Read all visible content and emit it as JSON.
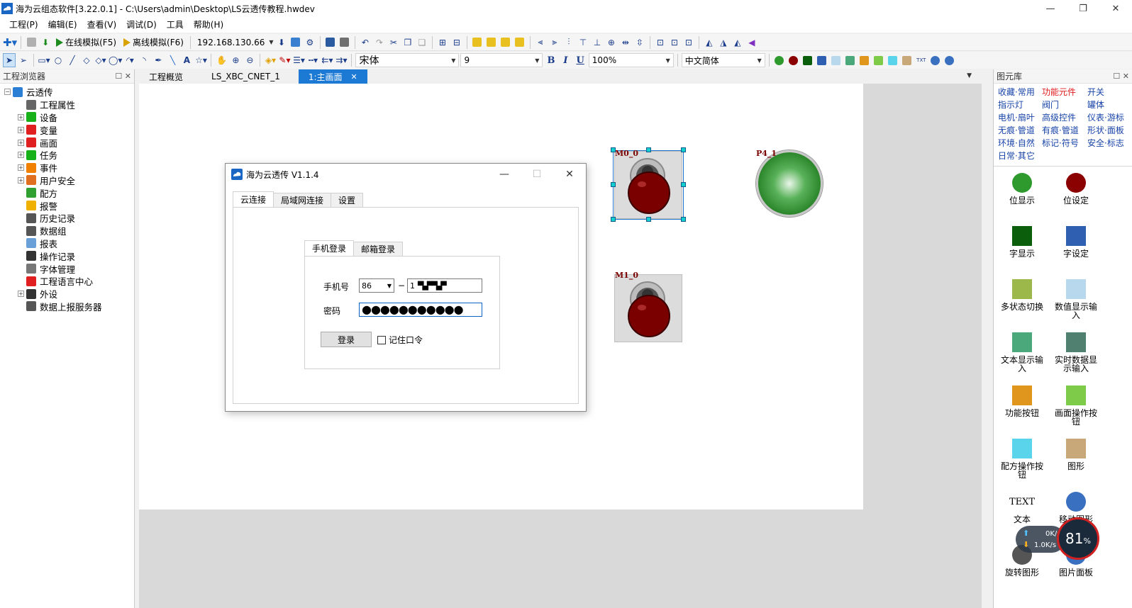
{
  "window": {
    "title": "海为云组态软件[3.22.0.1] - C:\\Users\\admin\\Desktop\\LS云透传教程.hwdev",
    "minimize": "—",
    "maximize": "❐",
    "close": "✕"
  },
  "menu": [
    "工程(P)",
    "编辑(E)",
    "查看(V)",
    "调试(D)",
    "工具",
    "帮助(H)"
  ],
  "toolbar1": {
    "online_sim": "在线模拟(F5)",
    "offline_sim": "离线模拟(F6)",
    "ip": "192.168.130.66"
  },
  "toolbar2": {
    "font": "宋体",
    "size": "9",
    "zoom": "100%",
    "language": "中文简体",
    "bold": "B",
    "italic": "I",
    "underline": "U",
    "text_tool": "A"
  },
  "left_panel": {
    "title": "工程浏览器",
    "pin": "☐ ✕",
    "tree": [
      {
        "label": "云透传",
        "level": 0,
        "expander": "−",
        "icon": "project-icon",
        "color": "#2a7fd4"
      },
      {
        "label": "工程属性",
        "level": 1,
        "expander": "",
        "icon": "properties-icon",
        "color": "#666666"
      },
      {
        "label": "设备",
        "level": 1,
        "expander": "+",
        "icon": "device-icon",
        "color": "#18b018"
      },
      {
        "label": "变量",
        "level": 1,
        "expander": "+",
        "icon": "variable-icon",
        "color": "#e02020"
      },
      {
        "label": "画面",
        "level": 1,
        "expander": "+",
        "icon": "screen-icon",
        "color": "#e02020"
      },
      {
        "label": "任务",
        "level": 1,
        "expander": "+",
        "icon": "task-icon",
        "color": "#18b018"
      },
      {
        "label": "事件",
        "level": 1,
        "expander": "+",
        "icon": "event-icon",
        "color": "#f08000"
      },
      {
        "label": "用户安全",
        "level": 1,
        "expander": "+",
        "icon": "user-security-icon",
        "color": "#e07020"
      },
      {
        "label": "配方",
        "level": 1,
        "expander": "",
        "icon": "recipe-icon",
        "color": "#30a030"
      },
      {
        "label": "报警",
        "level": 1,
        "expander": "",
        "icon": "alarm-bell-icon",
        "color": "#f0b000"
      },
      {
        "label": "历史记录",
        "level": 1,
        "expander": "",
        "icon": "history-icon",
        "color": "#555555"
      },
      {
        "label": "数据组",
        "level": 1,
        "expander": "",
        "icon": "data-group-icon",
        "color": "#555555"
      },
      {
        "label": "报表",
        "level": 1,
        "expander": "",
        "icon": "report-icon",
        "color": "#6aa0d8"
      },
      {
        "label": "操作记录",
        "level": 1,
        "expander": "",
        "icon": "operation-log-icon",
        "color": "#333333"
      },
      {
        "label": "字体管理",
        "level": 1,
        "expander": "",
        "icon": "font-manager-icon",
        "color": "#777777"
      },
      {
        "label": "工程语言中心",
        "level": 1,
        "expander": "",
        "icon": "language-center-icon",
        "color": "#e02020"
      },
      {
        "label": "外设",
        "level": 1,
        "expander": "+",
        "icon": "peripheral-icon",
        "color": "#333333"
      },
      {
        "label": "数据上报服务器",
        "level": 1,
        "expander": "",
        "icon": "report-server-icon",
        "color": "#555555"
      }
    ]
  },
  "doc_tabs": [
    {
      "label": "工程概览",
      "active": false
    },
    {
      "label": "LS_XBC_CNET_1",
      "active": false
    },
    {
      "label": "1:主画面",
      "active": true
    }
  ],
  "canvas": {
    "components": {
      "m0": "M0_0",
      "m1": "M1_0",
      "p4": "P4_1"
    }
  },
  "dialog": {
    "title": "海为云透传 V1.1.4",
    "tabs": [
      "云连接",
      "局域网连接",
      "设置"
    ],
    "login_tabs": [
      "手机登录",
      "邮箱登录"
    ],
    "phone_label": "手机号",
    "country_code": "86",
    "dash": "−",
    "phone_value": "1",
    "password_label": "密码",
    "password_value": "●●●●●●●●●●●",
    "login_button": "登录",
    "remember": "记住口令"
  },
  "right_panel": {
    "title": "图元库",
    "pin": "☐ ✕",
    "categories": [
      {
        "label": "收藏·常用",
        "active": false
      },
      {
        "label": "功能元件",
        "active": true
      },
      {
        "label": "开关",
        "active": false
      },
      {
        "label": "指示灯",
        "active": false
      },
      {
        "label": "阀门",
        "active": false
      },
      {
        "label": "罐体",
        "active": false
      },
      {
        "label": "电机·扇叶",
        "active": false
      },
      {
        "label": "高级控件",
        "active": false
      },
      {
        "label": "仪表·游标",
        "active": false
      },
      {
        "label": "无痕·管道",
        "active": false
      },
      {
        "label": "有痕·管道",
        "active": false
      },
      {
        "label": "形状·面板",
        "active": false
      },
      {
        "label": "环境·自然",
        "active": false
      },
      {
        "label": "标记·符号",
        "active": false
      },
      {
        "label": "安全·标志",
        "active": false
      },
      {
        "label": "日常·其它",
        "active": false
      }
    ],
    "items": [
      {
        "label": "位显示",
        "icon": "bit-display-icon",
        "color": "#2e9a2e"
      },
      {
        "label": "位设定",
        "icon": "bit-set-icon",
        "color": "#8b0000"
      },
      {
        "label": "字显示",
        "icon": "word-display-icon",
        "color": "#0b5e0b"
      },
      {
        "label": "字设定",
        "icon": "word-set-icon",
        "color": "#2f5fb0"
      },
      {
        "label": "多状态切换",
        "icon": "multi-state-icon",
        "color": "#9cb84a"
      },
      {
        "label": "数值显示输入",
        "icon": "numeric-input-icon",
        "color": "#b8d8ee"
      },
      {
        "label": "文本显示输入",
        "icon": "text-input-icon",
        "color": "#4aa87a"
      },
      {
        "label": "实时数据显示输入",
        "icon": "realtime-data-icon",
        "color": "#4f8070"
      },
      {
        "label": "功能按钮",
        "icon": "function-button-icon",
        "color": "#e0951c"
      },
      {
        "label": "画面操作按钮",
        "icon": "screen-button-icon",
        "color": "#7ecb4a"
      },
      {
        "label": "配方操作按钮",
        "icon": "recipe-button-icon",
        "color": "#5ad4ea"
      },
      {
        "label": "图形",
        "icon": "picture-icon",
        "color": "#c8a878"
      },
      {
        "label": "文本",
        "icon": "text-icon",
        "color": "#000000",
        "glyph": "TEXT"
      },
      {
        "label": "移动图形",
        "icon": "move-graphic-icon",
        "color": "#3a70c0"
      },
      {
        "label": "旋转图形",
        "icon": "rotate-graphic-icon",
        "color": "#555555"
      },
      {
        "label": "图片面板",
        "icon": "picture-panel-icon",
        "color": "#3a70c0"
      }
    ]
  },
  "speed_widget": {
    "upload": "0K/s",
    "download": "1.0K/s",
    "percent": "81",
    "unit": "%"
  }
}
